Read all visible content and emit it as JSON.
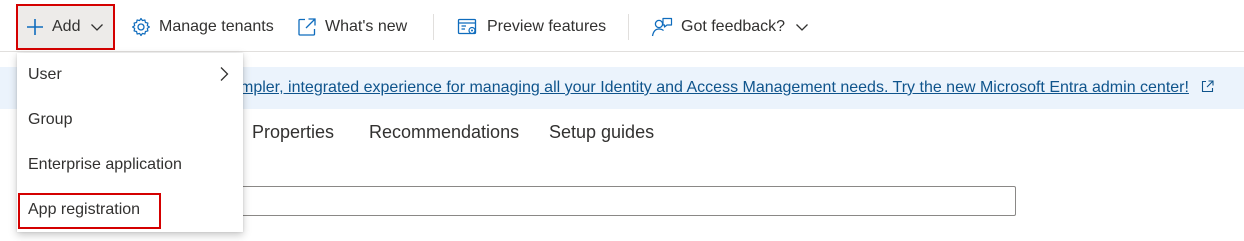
{
  "toolbar": {
    "add_label": "Add",
    "manage_tenants_label": "Manage tenants",
    "whats_new_label": "What's new",
    "preview_features_label": "Preview features",
    "feedback_label": "Got feedback?"
  },
  "banner": {
    "text": "mpler, integrated experience for managing all your Identity and Access Management needs. Try the new Microsoft Entra admin center!"
  },
  "tabs": [
    "Properties",
    "Recommendations",
    "Setup guides"
  ],
  "add_menu": {
    "items": [
      {
        "label": "User",
        "has_submenu": true
      },
      {
        "label": "Group",
        "has_submenu": false
      },
      {
        "label": "Enterprise application",
        "has_submenu": false
      },
      {
        "label": "App registration",
        "has_submenu": false
      }
    ],
    "highlighted_item": "App registration"
  },
  "search": {
    "value": ""
  },
  "colors": {
    "accent": "#0f6cbd",
    "link": "#0f548c",
    "highlight_border": "#d40000",
    "banner_bg": "#ebf3fc",
    "add_button_bg": "#edebe9"
  },
  "icons": {
    "add": "plus-icon",
    "dropdown": "chevron-down-icon",
    "manage_tenants": "gear-icon",
    "whats_new": "external-link-icon",
    "preview_features": "preview-features-icon",
    "feedback": "feedback-person-icon",
    "submenu": "chevron-right-icon"
  }
}
